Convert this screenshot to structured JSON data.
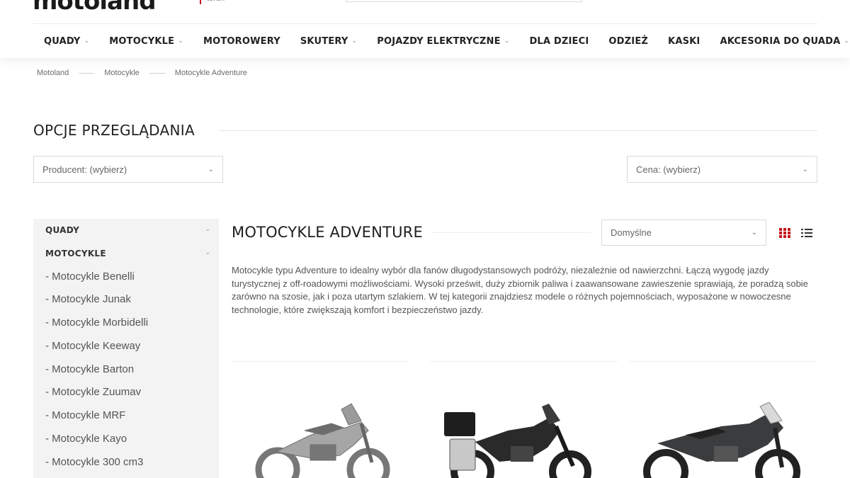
{
  "header": {
    "logo_text": "motoland",
    "logo_sub": "torun"
  },
  "nav": [
    {
      "label": "QUADY",
      "has_dropdown": true
    },
    {
      "label": "MOTOCYKLE",
      "has_dropdown": true
    },
    {
      "label": "MOTOROWERY",
      "has_dropdown": false
    },
    {
      "label": "SKUTERY",
      "has_dropdown": true
    },
    {
      "label": "POJAZDY ELEKTRYCZNE",
      "has_dropdown": true
    },
    {
      "label": "DLA DZIECI",
      "has_dropdown": false
    },
    {
      "label": "ODZIEŻ",
      "has_dropdown": false
    },
    {
      "label": "KASKI",
      "has_dropdown": false
    },
    {
      "label": "AKCESORIA DO QUADA",
      "has_dropdown": true
    }
  ],
  "breadcrumb": [
    "Motoland",
    "Motocykle",
    "Motocykle Adventure"
  ],
  "options": {
    "title": "OPCJE PRZEGLĄDANIA",
    "producer_select": "Producent: (wybierz)",
    "price_select": "Cena: (wybierz)"
  },
  "sidebar": {
    "categories": [
      "QUADY",
      "MOTOCYKLE"
    ],
    "items": [
      "- Motocykle Benelli",
      "- Motocykle Junak",
      "- Motocykle Morbidelli",
      "- Motocykle Keeway",
      "- Motocykle Barton",
      "- Motocykle Zuumav",
      "- Motocykle MRF",
      "- Motocykle Kayo",
      "- Motocykle 300 cm3"
    ]
  },
  "main": {
    "title": "MOTOCYKLE ADVENTURE",
    "sort_select": "Domyślne",
    "description": "Motocykle typu Adventure to idealny wybór dla fanów długodystansowych podróży, niezależnie od nawierzchni. Łączą wygodę jazdy turystycznej z off-roadowymi możliwościami. Wysoki prześwit, duży zbiornik paliwa i zaawansowane zawieszenie sprawiają, że poradzą sobie zarówno na szosie, jak i poza utartym szlakiem. W tej kategorii znajdziesz modele o różnych pojemnościach, wyposażone w nowoczesne technologie, które zwiększają komfort i bezpieczeństwo jazdy."
  },
  "colors": {
    "accent": "#c4161c",
    "sidebar_bg": "#f3f3f3"
  },
  "icons": {
    "grid_view": "grid-view-icon",
    "list_view": "list-view-icon",
    "chevron": "chevron-down-icon"
  }
}
